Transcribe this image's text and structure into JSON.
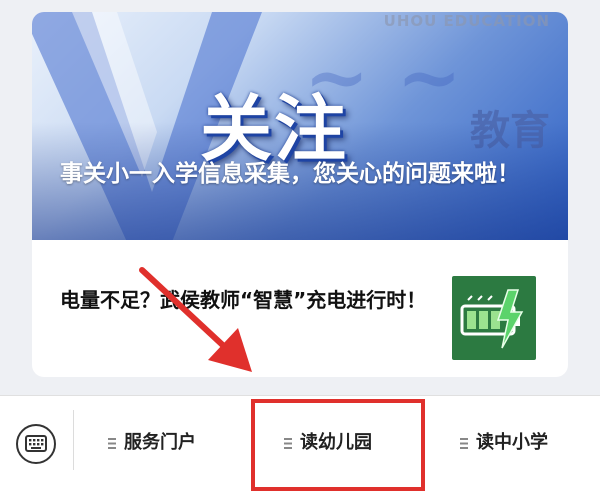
{
  "articles": [
    {
      "banner_big_text": "关注",
      "banner_watermark": "UHOU EDUCATION",
      "banner_brand": "教育",
      "title": "事关小一入学信息采集，您关心的问题来啦！"
    },
    {
      "title": "电量不足？武侯教师“智慧”充电进行时！",
      "thumb_icon": "battery-charging-icon"
    }
  ],
  "menu": {
    "keyboard_icon": "keyboard-icon",
    "items": [
      {
        "label": "服务门户",
        "icon": "menu-lines-icon"
      },
      {
        "label": "读幼儿园",
        "icon": "menu-lines-icon"
      },
      {
        "label": "读中小学",
        "icon": "menu-lines-icon"
      }
    ]
  },
  "annotations": {
    "arrow_color": "#e0302c",
    "highlight_color": "#e0302c"
  },
  "colors": {
    "banner_blue": "#2c5fc4",
    "thumb_green": "#2c7a41",
    "charge_green": "#5bd36b"
  }
}
